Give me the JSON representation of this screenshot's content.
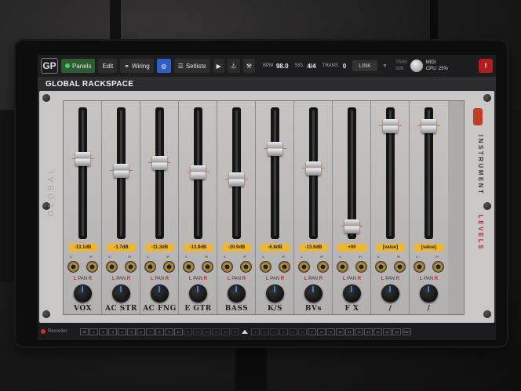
{
  "toolbar": {
    "logo": "GP",
    "panels_label": "Panels",
    "edit_label": "Edit",
    "wiring_label": "Wiring",
    "setlists_label": "Setlists",
    "bpm_label": "BPM",
    "bpm_value": "98.0",
    "sig_label": "SIG.",
    "sig_value": "4/4",
    "trans_label": "TRANS.",
    "trans_value": "0",
    "link_label": "LINK",
    "trim_label": "TRIM",
    "trim_value": "0dB",
    "midi_label": "MIDI",
    "cpu_label": "CPU:",
    "cpu_value": "25%",
    "alert_label": "!"
  },
  "rackspace": {
    "title": "GLOBAL RACKSPACE",
    "global_label": "GLOBAL",
    "side_label_instrument": "INSTRUMENT",
    "side_label_levels": "LEVELS"
  },
  "channels": [
    {
      "name": "VOX",
      "value": "-13.1dB",
      "fader_level": 0.62
    },
    {
      "name": "AC STR",
      "value": "-1.7dB",
      "fader_level": 0.52
    },
    {
      "name": "AC FNG",
      "value": "-11.3dB",
      "fader_level": 0.59
    },
    {
      "name": "E GTR",
      "value": "-13.9dB",
      "fader_level": 0.51
    },
    {
      "name": "BASS",
      "value": "-20.9dB",
      "fader_level": 0.45
    },
    {
      "name": "K/S",
      "value": "-6.8dB",
      "fader_level": 0.71
    },
    {
      "name": "BVs",
      "value": "-13.9dB",
      "fader_level": 0.54
    },
    {
      "name": "F X",
      "value": "+00",
      "fader_level": 0.05
    },
    {
      "name": "/",
      "value": "[value]",
      "fader_level": 0.9
    },
    {
      "name": "/",
      "value": "[value]",
      "fader_level": 0.9
    }
  ],
  "strip": {
    "jack_l": "/L",
    "jack_r": "/R",
    "pan_l": "L",
    "pan_label": "PAN",
    "pan_r": "R"
  },
  "bottombar": {
    "recorder_label": "Recorder",
    "in_label": "IN",
    "out_label": "OUT",
    "midi_channels": [
      "1",
      "2",
      "3",
      "4",
      "5",
      "6",
      "7",
      "8",
      "9",
      "10",
      "11",
      "12",
      "13",
      "14",
      "15",
      "16",
      "1",
      "2",
      "3",
      "4",
      "5",
      "6",
      "7",
      "8",
      "9",
      "10",
      "11",
      "12",
      "13",
      "14",
      "15",
      "16"
    ]
  },
  "colors": {
    "accent_orange": "#f0b72b",
    "panels_green": "#2d5a30",
    "globe_blue": "#2d5ec4",
    "alert_red": "#b01e1e",
    "levels_red": "#b5262a"
  }
}
